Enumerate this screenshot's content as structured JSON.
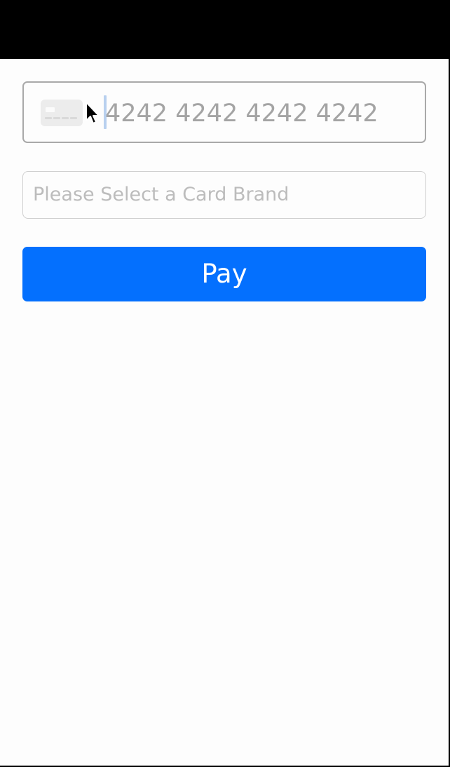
{
  "payment_form": {
    "card_number": {
      "placeholder": "4242 4242 4242 4242",
      "icon": "credit-card-icon"
    },
    "card_brand": {
      "placeholder": "Please Select a Card Brand"
    },
    "pay_button": {
      "label": "Pay"
    }
  },
  "colors": {
    "accent": "#0470fe",
    "placeholder_text": "#a4a4a4",
    "field_border": "#a9a9a9"
  }
}
